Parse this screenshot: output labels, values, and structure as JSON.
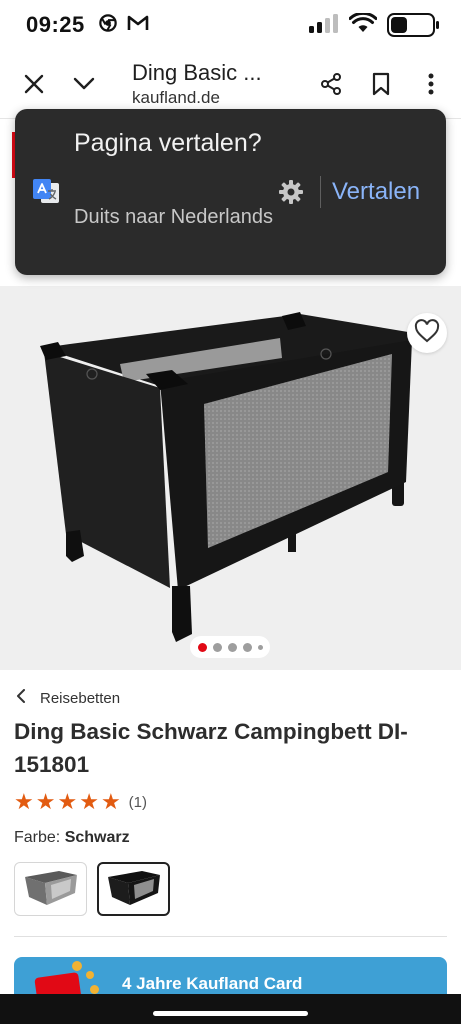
{
  "status_bar": {
    "time": "09:25",
    "icons": [
      "chrome-icon",
      "gmail-icon",
      "signal-icon",
      "wifi-icon",
      "battery-icon"
    ],
    "battery_level": 0.4
  },
  "browser": {
    "title": "Ding Basic ...",
    "url": "kaufland.de",
    "icons": [
      "close-icon",
      "chevron-down-icon",
      "share-icon",
      "bookmark-icon",
      "more-vert-icon"
    ]
  },
  "translate_prompt": {
    "question": "Pagina vertalen?",
    "subtitle": "Duits naar Nederlands",
    "action_label": "Vertalen",
    "accent_color": "#8ab4f8"
  },
  "product": {
    "breadcrumb": "Reisebetten",
    "title": "Ding Basic Schwarz Campingbett DI-151801",
    "rating": 5,
    "rating_count": "(1)",
    "color_label": "Farbe:",
    "color_value": "Schwarz",
    "image_index": 1,
    "image_count": 5,
    "brand_color": "#e10915",
    "star_color": "#e25b11"
  },
  "promo": {
    "text": "4 Jahre Kaufland Card",
    "color": "#3ea0d5"
  }
}
